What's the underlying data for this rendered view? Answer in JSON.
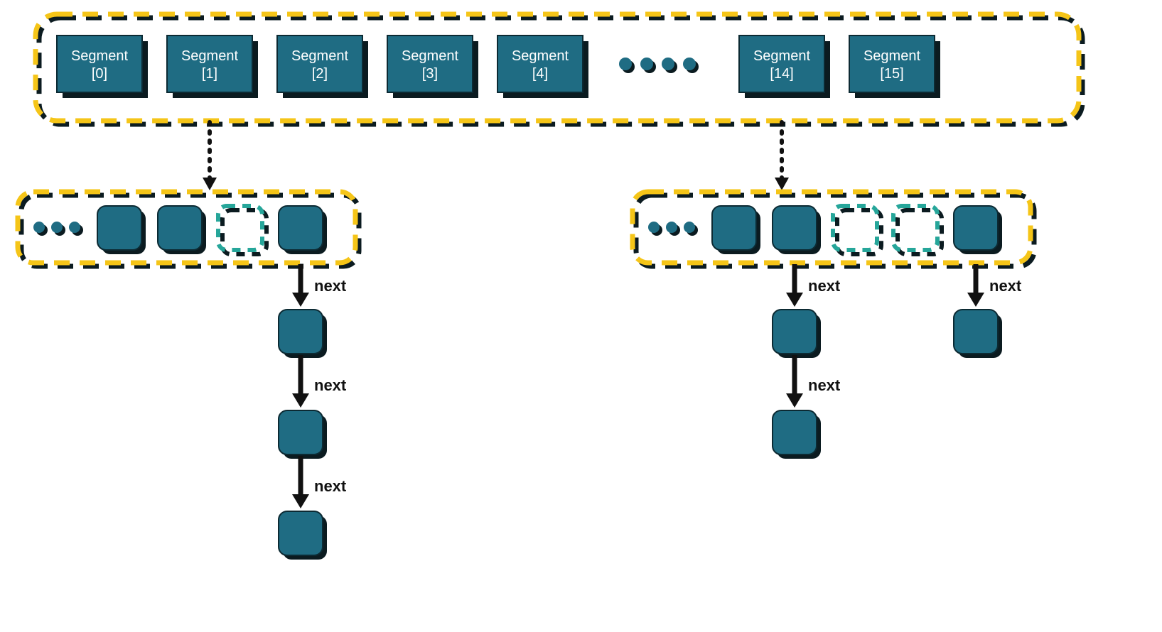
{
  "colors": {
    "segment_fill": "#1f6c83",
    "segment_stroke": "#0c2a33",
    "dashed_border": "#f5c518",
    "dashed_slot": "#26a69a",
    "shadow": "#0b1b20",
    "arrow": "#111111",
    "dots": "#1f6c83"
  },
  "segments": {
    "label_prefix": "Segment",
    "indices": [
      "[0]",
      "[1]",
      "[2]",
      "[3]",
      "[4]",
      "[14]",
      "[15]"
    ]
  },
  "arrows": {
    "next_label": "next"
  }
}
